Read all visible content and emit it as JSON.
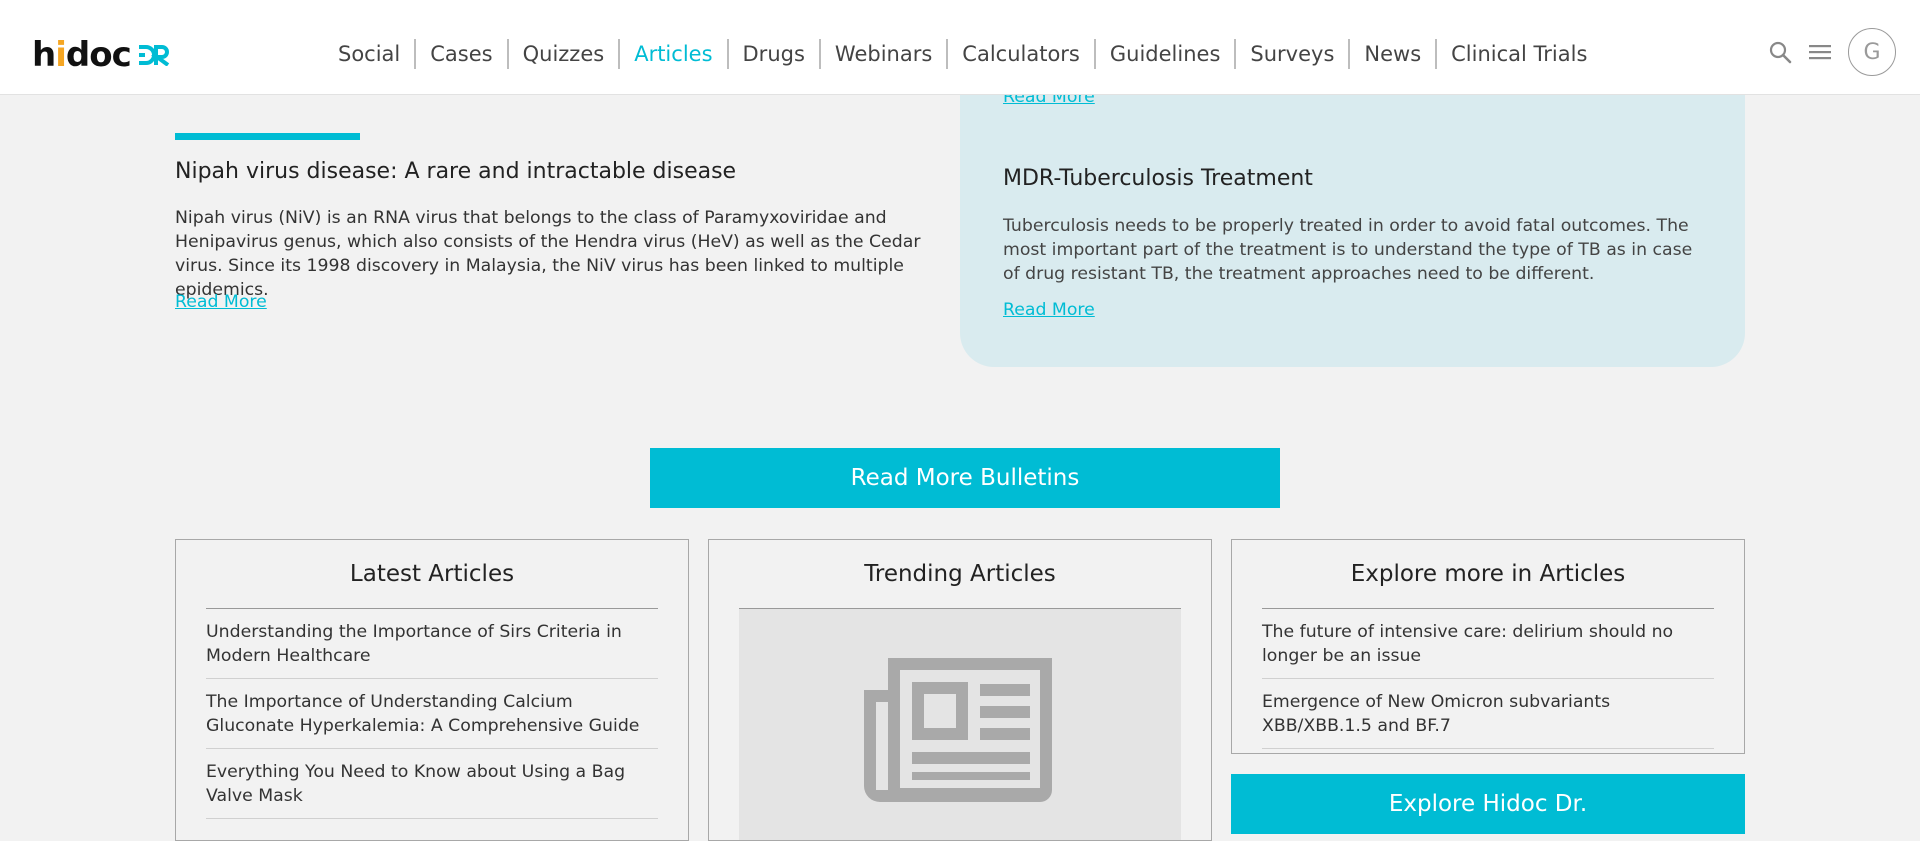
{
  "header": {
    "logo": {
      "brand": "hidoc",
      "suffix": "DR"
    },
    "nav": [
      {
        "label": "Social",
        "active": false
      },
      {
        "label": "Cases",
        "active": false
      },
      {
        "label": "Quizzes",
        "active": false
      },
      {
        "label": "Articles",
        "active": true
      },
      {
        "label": "Drugs",
        "active": false
      },
      {
        "label": "Webinars",
        "active": false
      },
      {
        "label": "Calculators",
        "active": false
      },
      {
        "label": "Guidelines",
        "active": false
      },
      {
        "label": "Surveys",
        "active": false
      },
      {
        "label": "News",
        "active": false
      },
      {
        "label": "Clinical Trials",
        "active": false
      }
    ],
    "icons": [
      "search-icon",
      "menu-icon"
    ],
    "avatar_initial": "G"
  },
  "bulletins": {
    "left": {
      "title": "Nipah virus disease: A rare and intractable disease",
      "description": "Nipah virus (NiV) is an RNA virus that belongs to the class of Paramyxoviridae and Henipavirus genus, which also consists of the Hendra virus (HeV) as well as the Cedar virus. Since its 1998 discovery in Malaysia, the NiV virus has been linked to multiple epidemics.",
      "read_more": "Read More"
    },
    "right": {
      "read_more_top": "Read More",
      "title": "MDR-Tuberculosis Treatment",
      "description": "Tuberculosis needs to be properly treated in order to avoid fatal outcomes. The most important part of the treatment is to understand the type of TB as in case of drug resistant TB, the treatment approaches need to be different.",
      "read_more": "Read More"
    },
    "cta": "Read More Bulletins"
  },
  "latest": {
    "heading": "Latest Articles",
    "items": [
      "Understanding the Importance of Sirs Criteria in Modern Healthcare",
      "The Importance of Understanding Calcium Gluconate Hyperkalemia: A Comprehensive Guide",
      "Everything You Need to Know about Using a Bag Valve Mask"
    ]
  },
  "trending": {
    "heading": "Trending Articles",
    "image_icon": "newspaper-icon"
  },
  "explore": {
    "heading": "Explore more in Articles",
    "items": [
      "The future of intensive care: delirium should no longer be an issue",
      "Emergence of New Omicron subvariants XBB/XBB.1.5 and BF.7"
    ],
    "button": "Explore Hidoc Dr."
  },
  "colors": {
    "accent": "#00bcd4",
    "panel": "#d9ebef",
    "background": "#f2f2f2",
    "logo_dot": "#f5a623"
  }
}
